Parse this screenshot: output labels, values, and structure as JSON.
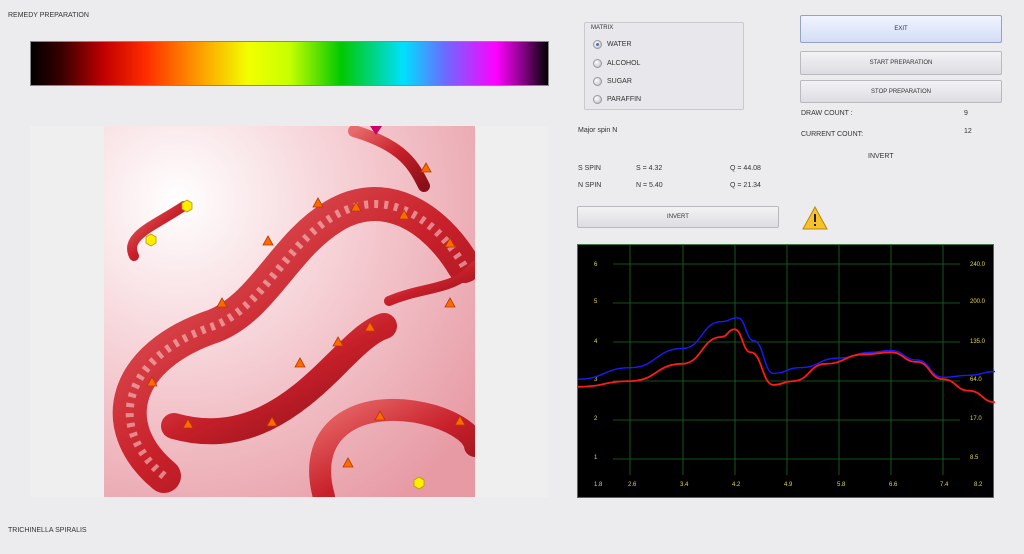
{
  "header": {
    "title": "REMEDY PREPARATION"
  },
  "footer": {
    "label": "TRICHINELLA SPIRALIS"
  },
  "matrix": {
    "legend": "MATRIX",
    "options": [
      {
        "label": "WATER",
        "selected": true
      },
      {
        "label": "ALCOHOL",
        "selected": false
      },
      {
        "label": "SUGAR",
        "selected": false
      },
      {
        "label": "PARAFFIN",
        "selected": false
      }
    ]
  },
  "controls": {
    "exit": "EXIT",
    "start": "START PREPARATION",
    "stop": "STOP PREPARATION",
    "draw_count_label": "DRAW COUNT :",
    "draw_count_value": "9",
    "current_count_label": "CURRENT COUNT:",
    "current_count_value": "12",
    "invert_label": "INVERT"
  },
  "spin": {
    "major": "Major spin N",
    "s_label": "S SPIN",
    "s_value": "S = 4.32",
    "s_q": "Q = 44.08",
    "n_label": "N SPIN",
    "n_value": "N = 5.40",
    "n_q": "Q = 21.34",
    "invert_button": "INVERT"
  },
  "chart_data": {
    "type": "line",
    "x_ticks": [
      "1.8",
      "2.6",
      "3.4",
      "4.2",
      "4.9",
      "5.8",
      "6.6",
      "7.4",
      "8.2"
    ],
    "y_left_ticks": [
      "1",
      "2",
      "3",
      "4",
      "5",
      "6"
    ],
    "y_right_ticks": [
      "8.5",
      "17.0",
      "64.0",
      "135.0",
      "200.0",
      "240.0"
    ],
    "ylim": [
      0.5,
      6.5
    ],
    "xlim": [
      1.8,
      8.2
    ],
    "grid": true,
    "series": [
      {
        "color": "#1a1aff",
        "x": [
          1.8,
          2.6,
          3.4,
          4.0,
          4.25,
          4.5,
          4.8,
          5.2,
          5.8,
          6.3,
          6.6,
          7.0,
          7.4,
          7.8,
          8.2
        ],
        "y": [
          3.0,
          3.3,
          3.8,
          4.5,
          4.6,
          4.0,
          3.15,
          3.3,
          3.55,
          3.7,
          3.75,
          3.5,
          3.05,
          3.1,
          3.2
        ]
      },
      {
        "color": "#ff1a1a",
        "x": [
          1.8,
          2.6,
          3.4,
          4.0,
          4.2,
          4.45,
          4.8,
          5.1,
          5.6,
          6.2,
          6.6,
          7.0,
          7.4,
          7.8,
          8.2
        ],
        "y": [
          2.8,
          2.95,
          3.4,
          4.1,
          4.3,
          3.7,
          2.85,
          2.95,
          3.4,
          3.65,
          3.7,
          3.45,
          3.0,
          2.7,
          2.4
        ]
      }
    ]
  }
}
